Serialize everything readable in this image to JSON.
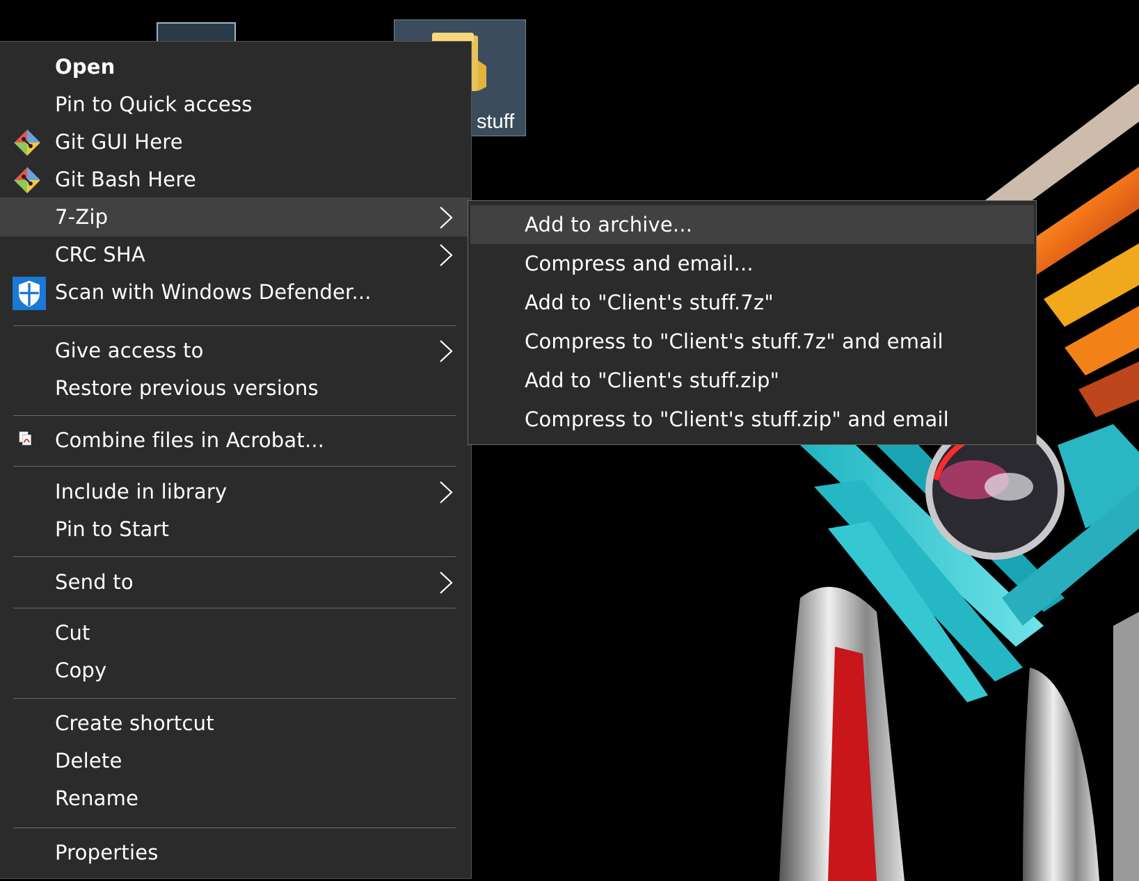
{
  "desktop": {
    "folder_label": "stuff"
  },
  "context_menu": {
    "items": [
      {
        "label": "Open"
      },
      {
        "label": "Pin to Quick access"
      },
      {
        "label": "Git GUI Here",
        "icon": "git-icon"
      },
      {
        "label": "Git Bash Here",
        "icon": "git-icon"
      },
      {
        "label": "7-Zip",
        "submenu": true,
        "highlighted": true
      },
      {
        "label": "CRC SHA",
        "submenu": true
      },
      {
        "label": "Scan with Windows Defender...",
        "icon": "windows-defender-shield-icon"
      },
      {
        "label": "Give access to",
        "submenu": true
      },
      {
        "label": "Restore previous versions"
      },
      {
        "label": "Combine files in Acrobat...",
        "icon": "acrobat-icon"
      },
      {
        "label": "Include in library",
        "submenu": true
      },
      {
        "label": "Pin to Start"
      },
      {
        "label": "Send to",
        "submenu": true
      },
      {
        "label": "Cut"
      },
      {
        "label": "Copy"
      },
      {
        "label": "Create shortcut"
      },
      {
        "label": "Delete"
      },
      {
        "label": "Rename"
      },
      {
        "label": "Properties"
      }
    ]
  },
  "submenu_7zip": {
    "items": [
      {
        "label": "Add to archive...",
        "highlighted": true
      },
      {
        "label": "Compress and email..."
      },
      {
        "label": "Add to \"Client's stuff.7z\""
      },
      {
        "label": "Compress to \"Client's stuff.7z\" and email"
      },
      {
        "label": "Add to \"Client's stuff.zip\""
      },
      {
        "label": "Compress to \"Client's stuff.zip\" and email"
      }
    ]
  },
  "colors": {
    "menu_bg": "#2b2b2b",
    "highlight_bg": "#414141",
    "separator": "#6a6a6a",
    "text": "#ffffff"
  }
}
